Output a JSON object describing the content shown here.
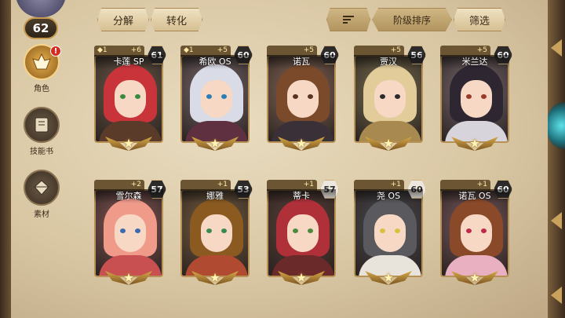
{
  "player": {
    "level": "62"
  },
  "sidebar": {
    "items": [
      {
        "label": "角色",
        "icon": "hero-icon",
        "active": true,
        "alert": "!"
      },
      {
        "label": "技能书",
        "icon": "skillbook-icon",
        "active": false
      },
      {
        "label": "素材",
        "icon": "material-icon",
        "active": false
      }
    ]
  },
  "toolbar": {
    "decompose_label": "分解",
    "convert_label": "转化",
    "sort_icon": "sort-icon",
    "sort_label": "阶级排序",
    "filter_label": "筛选"
  },
  "heroes": [
    {
      "name": "卡莲 SP",
      "level": "61",
      "star_left": "◆1",
      "star_right": "+6",
      "hair": "#c8343a",
      "bg": "#6d5a49",
      "eye": "#3a8a40",
      "outfit": "#5a3b2a"
    },
    {
      "name": "希欧 OS",
      "level": "60",
      "star_left": "◆1",
      "star_right": "+5",
      "hair": "#d9dbe6",
      "bg": "#7a6a6e",
      "eye": "#2a7fb6",
      "outfit": "#5e3040"
    },
    {
      "name": "诺瓦",
      "level": "60",
      "star_left": "",
      "star_right": "+5",
      "hair": "#7a4a2a",
      "bg": "#8a6a58",
      "eye": "#5a3320",
      "outfit": "#3a3038"
    },
    {
      "name": "贾汉",
      "level": "56",
      "star_left": "",
      "star_right": "+5",
      "hair": "#e2cc9a",
      "bg": "#7a7050",
      "eye": "#2a2a2a",
      "outfit": "#a88a50"
    },
    {
      "name": "米兰达",
      "level": "60",
      "star_left": "",
      "star_right": "+5",
      "hair": "#2e2630",
      "bg": "#7a6a70",
      "eye": "#9a3a2a",
      "outfit": "#d8d4dc"
    },
    {
      "name": "雪尔森",
      "level": "57",
      "star_left": "",
      "star_right": "+2",
      "hair": "#f09a8a",
      "bg": "#8a5a58",
      "eye": "#3a6ab0",
      "outfit": "#c85050"
    },
    {
      "name": "娜雅",
      "level": "53",
      "star_left": "",
      "star_right": "+1",
      "hair": "#8a5a20",
      "bg": "#7a6040",
      "eye": "#3a8a50",
      "outfit": "#b04a30"
    },
    {
      "name": "蒂卡",
      "level": "57",
      "star_left": "",
      "star_right": "+1",
      "hair": "#b0303a",
      "bg": "#5a4038",
      "eye": "#4a8a3a",
      "outfit": "#6a2a2a"
    },
    {
      "name": "尧 OS",
      "level": "60",
      "star_left": "",
      "star_right": "+1",
      "hair": "#5a5a5e",
      "bg": "#4a4a50",
      "eye": "#d8c040",
      "outfit": "#e8e4dc"
    },
    {
      "name": "诺瓦 OS",
      "level": "60",
      "star_left": "",
      "star_right": "+1",
      "hair": "#8a4a2a",
      "bg": "#7a5a60",
      "eye": "#c02a4a",
      "outfit": "#e8b0c0"
    }
  ],
  "hero_level_style": [
    "dark",
    "dark",
    "dark",
    "dark",
    "dark",
    "dark",
    "dark",
    "light",
    "light",
    "dark"
  ]
}
